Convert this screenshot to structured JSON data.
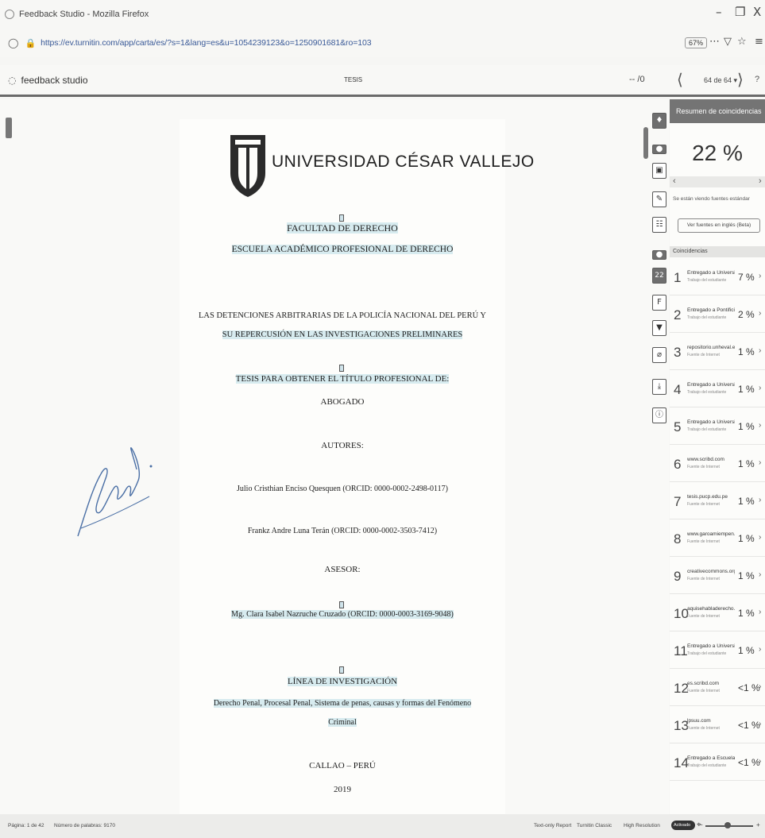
{
  "window": {
    "title": "Feedback Studio - Mozilla Firefox",
    "minimize": "–",
    "restore": "❐",
    "close": "X"
  },
  "browser": {
    "url": "https://ev.turnitin.com/app/carta/es/?s=1&lang=es&u=1054239123&o=1250901681&ro=103",
    "zoom": "67%",
    "more": "⋯",
    "pocket": "▽",
    "bookmark": "☆",
    "menu": "≡"
  },
  "studio": {
    "brand": "feedback studio",
    "document": "TESIS",
    "page_box": "-- /0",
    "page_select": "64 de 64 ▾",
    "help": "?"
  },
  "document": {
    "university": "UNIVERSIDAD CÉSAR VALLEJO",
    "faculty": "FACULTAD DE DERECHO",
    "school": "ESCUELA ACADÉMICO PROFESIONAL DE DERECHO",
    "title_line1": "LAS DETENCIONES ARBITRARIAS DE LA POLICÍA NACIONAL DEL PERÚ Y",
    "title_line2": "SU REPERCUSIÓN EN LAS INVESTIGACIONES PRELIMINARES",
    "thesis_for": "TESIS PARA OBTENER EL TÍTULO PROFESIONAL DE:",
    "degree": "ABOGADO",
    "authors_label": "AUTORES:",
    "author1": "Julio Cristhian Enciso Quesquen (ORCID: 0000-0002-2498-0117)",
    "author2": "Frankz Andre Luna Terán (ORCID: 0000-0002-3503-7412)",
    "advisor_label": "ASESOR:",
    "advisor": "Mg. Clara Isabel Nazruche Cruzado (ORCID: 0000-0003-3169-9048)",
    "research_label": "LÍNEA DE INVESTIGACIÓN",
    "research_line1": "Derecho Penal, Procesal Penal, Sistema de penas, causas y formas del Fenómeno",
    "research_line2": "Criminal",
    "city": "CALLAO – PERÚ",
    "year": "2019"
  },
  "toolstrip": {
    "layers": "♦",
    "grading": "▣",
    "feedback": "✎",
    "rubric": "☷",
    "similarity_score": "22",
    "filter": "▼",
    "exclude": "⌀",
    "download": "⤓",
    "info": "ⓘ"
  },
  "panel": {
    "header": "Resumen de coincidencias",
    "percentage": "22 %",
    "viewing": "Se están viendo fuentes estándar",
    "english_button": "Ver fuentes en inglés (Beta)",
    "matches_header": "Coincidencias",
    "matches": [
      {
        "n": "1",
        "source": "Entregado a Universida...",
        "type": "Trabajo del estudiante",
        "pct": "7 %"
      },
      {
        "n": "2",
        "source": "Entregado a Pontificia ...",
        "type": "Trabajo del estudiante",
        "pct": "2 %"
      },
      {
        "n": "3",
        "source": "repositorio.unheval.edu...",
        "type": "Fuente de Internet",
        "pct": "1 %"
      },
      {
        "n": "4",
        "source": "Entregado a Universida...",
        "type": "Trabajo del estudiante",
        "pct": "1 %"
      },
      {
        "n": "5",
        "source": "Entregado a Universida...",
        "type": "Trabajo del estudiante",
        "pct": "1 %"
      },
      {
        "n": "6",
        "source": "www.scribd.com",
        "type": "Fuente de Internet",
        "pct": "1 %"
      },
      {
        "n": "7",
        "source": "tesis.pucp.edu.pe",
        "type": "Fuente de Internet",
        "pct": "1 %"
      },
      {
        "n": "8",
        "source": "www.garoamiempen...",
        "type": "Fuente de Internet",
        "pct": "1 %"
      },
      {
        "n": "9",
        "source": "creativecommons.org",
        "type": "Fuente de Internet",
        "pct": "1 %"
      },
      {
        "n": "10",
        "source": "aquisehabladerecho.co...",
        "type": "Fuente de Internet",
        "pct": "1 %"
      },
      {
        "n": "11",
        "source": "Entregado a Universida...",
        "type": "Trabajo del estudiante",
        "pct": "1 %"
      },
      {
        "n": "12",
        "source": "es.scribd.com",
        "type": "Fuente de Internet",
        "pct": "<1 %"
      },
      {
        "n": "13",
        "source": "lpsuu.com",
        "type": "Fuente de Internet",
        "pct": "<1 %"
      },
      {
        "n": "14",
        "source": "Entregado a Escuela de...",
        "type": "Trabajo del estudiante",
        "pct": "<1 %"
      }
    ]
  },
  "status": {
    "page": "Página: 1 de 42",
    "words": "Número de palabras: 9170",
    "text_only": "Text-only Report",
    "classic": "Turnitin Classic",
    "high_res": "High Resolution",
    "toggle": "Activado",
    "zoom_out": "−",
    "zoom_in": "+"
  }
}
